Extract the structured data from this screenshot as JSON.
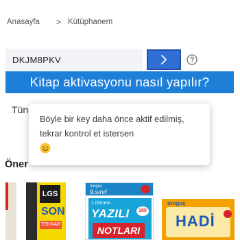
{
  "breadcrumb": {
    "home": "Anasayfa",
    "separator": ">",
    "current": "Kütüphanem"
  },
  "activation": {
    "code_value": "DKJM8PKV",
    "go_icon": "chevron-right-icon",
    "help_icon": "question-circle-icon"
  },
  "how_banner": {
    "label": "Kitap aktivasyonu nasıl yapılır?"
  },
  "sections": {
    "all_label": "Tün",
    "recommended_label": "Öner"
  },
  "tooltip": {
    "message": "Böyle bir key daha önce aktif edilmiş, tekrar kontrol et istersen",
    "emoji_icon": "smiling-face-icon"
  },
  "books": [
    {
      "name": "lgs-son-tekrar-spine"
    },
    {
      "name": "lgs-son-tekrar",
      "cover_title": "SON",
      "cover_top": "LGS",
      "cover_tag": "TEKRAR"
    },
    {
      "name": "yazili-notlari",
      "brand": "tonguç",
      "grade": "9.sınıf",
      "term": "1.Dönem",
      "title1": "YAZILI",
      "title2": "NOTLARI",
      "badge": "100"
    },
    {
      "name": "hadi",
      "brand": "tonguç",
      "title": "HADİ"
    }
  ],
  "colors": {
    "accent_blue": "#1e7fd9",
    "button_blue": "#2f6fd6",
    "input_bg": "#f1f3f6"
  }
}
